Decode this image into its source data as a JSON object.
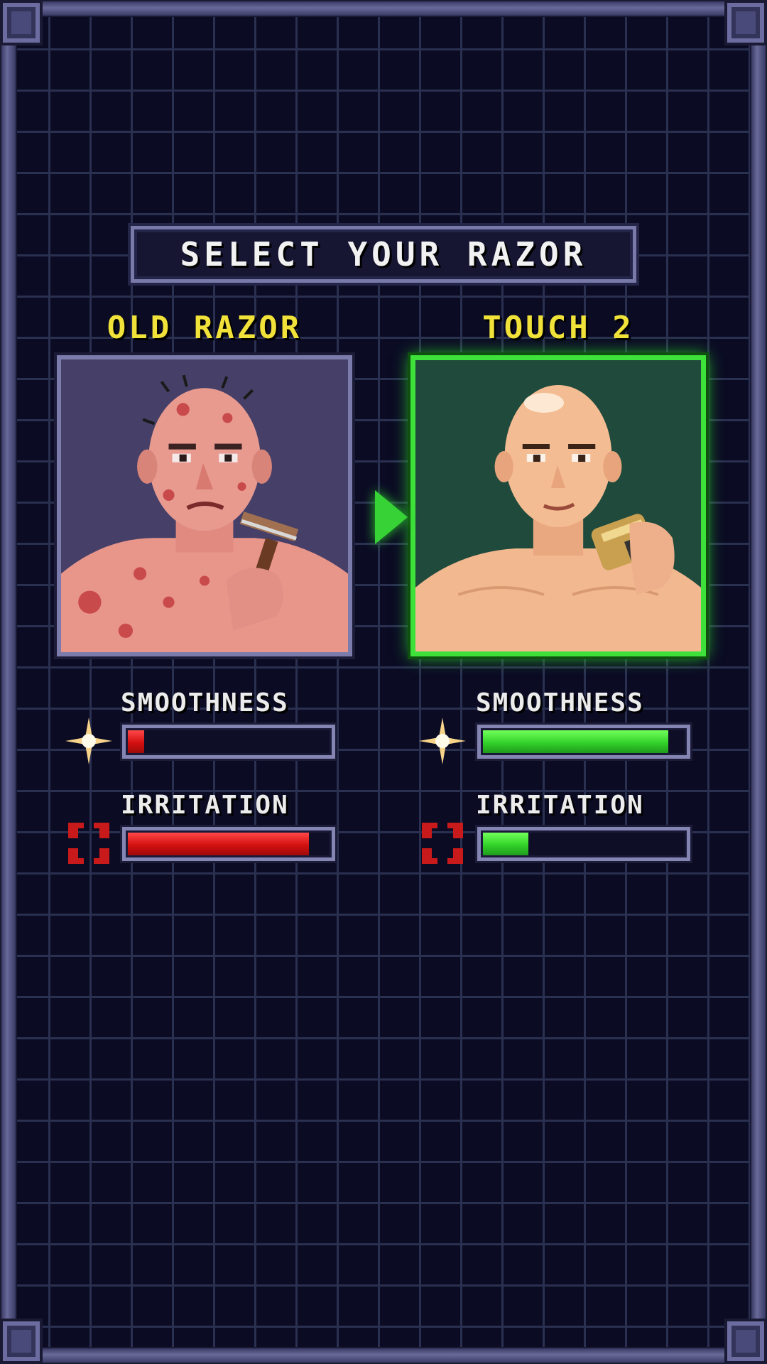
{
  "title": "SELECT YOUR RAZOR",
  "options": [
    {
      "name": "OLD RAZOR",
      "stats": {
        "smoothness_label": "SMOOTHNESS",
        "smoothness_level": 0.1,
        "irritation_label": "IRRITATION",
        "irritation_level": 0.9
      }
    },
    {
      "name": "TOUCH 2",
      "selected": true,
      "stats": {
        "smoothness_label": "SMOOTHNESS",
        "smoothness_level": 0.92,
        "irritation_label": "IRRITATION",
        "irritation_level": 0.24
      }
    }
  ],
  "icons": {
    "smoothness": "sparkle-icon",
    "irritation": "anger-icon",
    "selector": "arrow-right-icon"
  },
  "colors": {
    "title_text": "#f2f2f2",
    "option_title": "#f1e23a",
    "selected_border": "#3ee03a",
    "bad_bar": "#d31010",
    "good_bar": "#32d22a"
  }
}
